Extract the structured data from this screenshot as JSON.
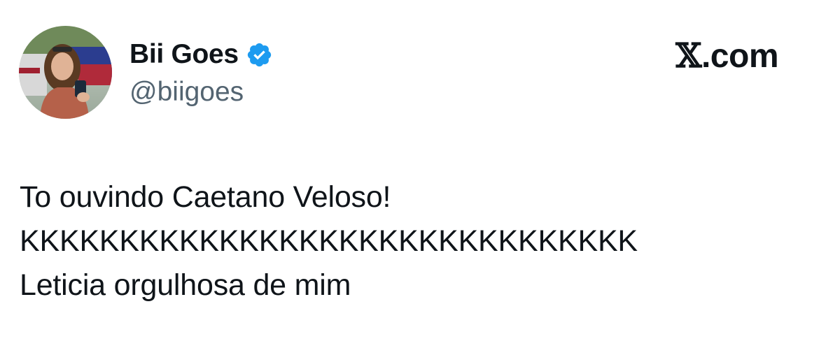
{
  "author": {
    "display_name": "Bii Goes",
    "handle": "@biigoes",
    "verified": true
  },
  "brand": {
    "x_symbol": "𝕏",
    "domain_suffix": ".com"
  },
  "tweet": {
    "lines": [
      "To ouvindo Caetano Veloso!",
      "KKKKKKKKKKKKKKKKKKKKKKKKKKKKKKK",
      "Leticia orgulhosa de mim"
    ]
  },
  "icons": {
    "verified": "verified-badge-icon",
    "avatar": "avatar"
  },
  "colors": {
    "text_primary": "#0f1419",
    "text_secondary": "#536471",
    "verified_blue": "#1d9bf0",
    "background": "#ffffff"
  }
}
